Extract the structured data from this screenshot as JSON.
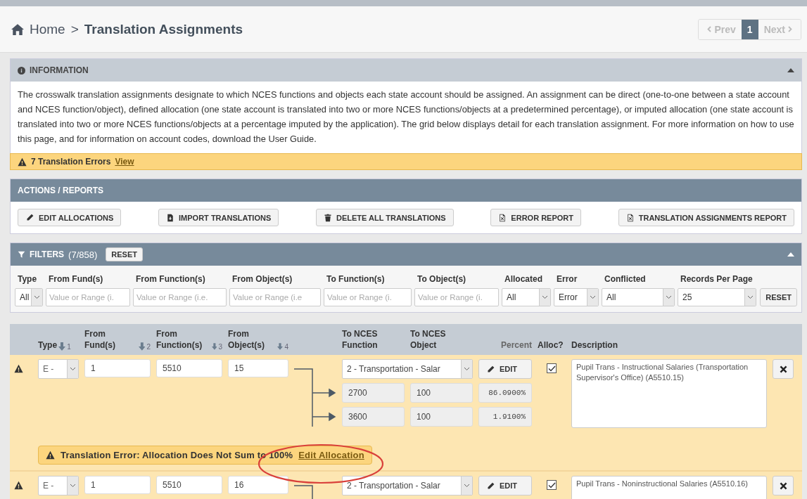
{
  "breadcrumb": {
    "home": "Home",
    "separator": ">",
    "current": "Translation Assignments"
  },
  "pagination": {
    "prev": "Prev",
    "pages": [
      {
        "label": "1",
        "selected": true
      }
    ],
    "next": "Next"
  },
  "info": {
    "title": "INFORMATION",
    "expanded": true,
    "text": "The crosswalk translation assignments designate to which NCES functions and objects each state account should be assigned. An assignment can be direct (one-to-one between a state account and NCES function/object), defined allocation (one state account is translated into two or more NCES functions/objects at a predetermined percentage), or imputed allocation (one state account is translated into two or more NCES functions/objects at a percentage imputed by the application). The grid below displays detail for each translation assignment. For more information on how to use this page, and for information on account codes, download the User Guide."
  },
  "errors_banner": {
    "text": "7 Translation Errors",
    "link": "View"
  },
  "actions": {
    "title": "ACTIONS / REPORTS",
    "buttons": [
      {
        "label": "EDIT ALLOCATIONS",
        "kind": "edit"
      },
      {
        "label": "IMPORT TRANSLATIONS",
        "kind": "import"
      },
      {
        "label": "DELETE ALL TRANSLATIONS",
        "kind": "delete"
      },
      {
        "label": "ERROR REPORT",
        "kind": "excel"
      },
      {
        "label": "TRANSLATION ASSIGNMENTS REPORT",
        "kind": "excel"
      }
    ]
  },
  "filters": {
    "title": "FILTERS",
    "count": "(7/858)",
    "reset": "RESET",
    "expanded": true,
    "fields": [
      {
        "label": "Type",
        "kind": "select",
        "value": "All"
      },
      {
        "label": "From Fund(s)",
        "kind": "text",
        "placeholder": "Value or Range (i."
      },
      {
        "label": "From Function(s)",
        "kind": "text",
        "placeholder": "Value or Range (i.e."
      },
      {
        "label": "From Object(s)",
        "kind": "text",
        "placeholder": "Value or Range (i.e"
      },
      {
        "label": "To Function(s)",
        "kind": "text",
        "placeholder": "Value or Range (i."
      },
      {
        "label": "To Object(s)",
        "kind": "text",
        "placeholder": "Value or Range (i."
      },
      {
        "label": "Allocated",
        "kind": "select",
        "value": "All"
      },
      {
        "label": "Error",
        "kind": "select",
        "value": "Error"
      },
      {
        "label": "Conflicted",
        "kind": "select",
        "value": "All"
      },
      {
        "label": "Records Per Page",
        "kind": "select",
        "value": "25"
      }
    ],
    "apply_reset": "RESET"
  },
  "table": {
    "columns": [
      {
        "label": "Type",
        "sort": "1"
      },
      {
        "label": "From Fund(s)",
        "sort": "2"
      },
      {
        "label": "From Function(s)",
        "sort": "3"
      },
      {
        "label": "From Object(s)",
        "sort": "4"
      },
      {
        "label": "To NCES Function"
      },
      {
        "label": "To NCES Object"
      },
      {
        "label": "Percent"
      },
      {
        "label": "Alloc?"
      },
      {
        "label": "Description"
      }
    ],
    "rows": [
      {
        "error": true,
        "type": "E -",
        "fund": "1",
        "function": "5510",
        "object": "15",
        "nces_function": "2 - Transportation - Salar",
        "edit": "EDIT",
        "allocated": true,
        "description": "Pupil Trans - Instructional Salaries (Transportation Supervisor's Office) (A5510.15)",
        "allocations": [
          {
            "function": "2700",
            "object": "100",
            "percent": "86.0900%"
          },
          {
            "function": "3600",
            "object": "100",
            "percent": "1.9100%"
          }
        ],
        "error_message": {
          "text": "Translation Error: Allocation Does Not Sum to 100%",
          "link": "Edit Allocation"
        }
      },
      {
        "error": true,
        "type": "E -",
        "fund": "1",
        "function": "5510",
        "object": "16",
        "nces_function": "2 - Transportation - Salar",
        "edit": "EDIT",
        "allocated": true,
        "description": "Pupil Trans - Noninstructional Salaries (A5510.16)",
        "allocations": []
      }
    ]
  }
}
